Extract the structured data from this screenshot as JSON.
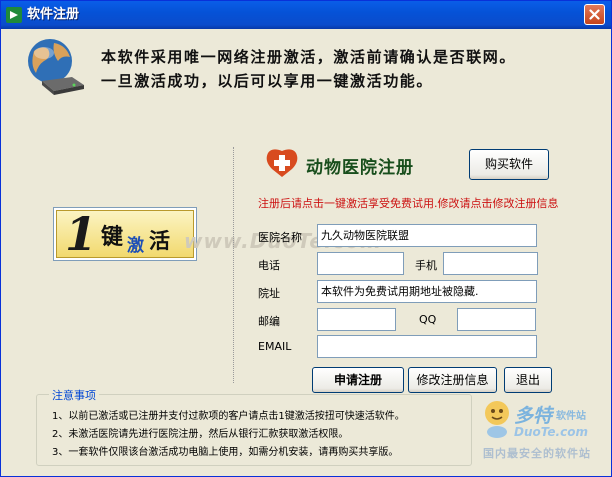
{
  "window": {
    "title": "软件注册",
    "close_label": "×"
  },
  "intro": {
    "line1": "本软件采用唯一网络注册激活，激活前请确认是否联网。",
    "line2": "一旦激活成功，以后可以享用一键激活功能。"
  },
  "onekey": {
    "char1": "1",
    "char2": "键",
    "char3": "激",
    "char4": "活"
  },
  "watermark": "www.DuoTe.com",
  "form": {
    "title": "动物医院注册",
    "buy_button": "购买软件",
    "notice": "注册后请点击一键激活享受免费试用.修改请点击修改注册信息",
    "hospital_name_label": "医院名称",
    "hospital_name_value": "九久动物医院联盟",
    "phone_label": "电话",
    "phone_value": "",
    "mobile_label": "手机",
    "mobile_value": "",
    "address_label": "院址",
    "address_value": "本软件为免费试用期地址被隐藏.",
    "zip_label": "邮编",
    "zip_value": "",
    "qq_label": "QQ",
    "qq_value": "",
    "email_label": "EMAIL",
    "email_value": ""
  },
  "actions": {
    "register": "申请注册",
    "modify": "修改注册信息",
    "exit": "退出"
  },
  "notes": {
    "title": "注意事项",
    "items": [
      "1、以前已激活或已注册并支付过款项的客户请点击1键激活按扭可快速活软件。",
      "2、未激活医院请先进行医院注册，然后从银行汇款获取激活权限。",
      "3、一套软件仅限该台激活成功电脑上使用，如需分机安装，请再购买共享版。"
    ]
  },
  "logo": {
    "name": "多特",
    "sub": "软件站",
    "url": "DuoTe.com",
    "tagline": "国内最安全的软件站"
  },
  "colors": {
    "titlebar": "#0552d7",
    "notice": "#cc1111",
    "notes_title": "#0046d5",
    "hospital_title": "#184e1c"
  },
  "icons": [
    "app-icon",
    "close-icon",
    "globe-icon",
    "hospital-cross-icon"
  ]
}
